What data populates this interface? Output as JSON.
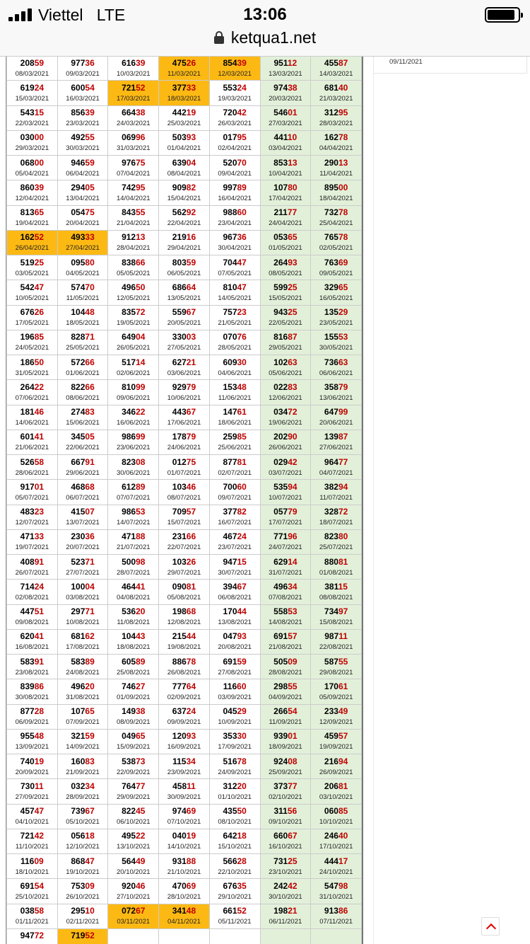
{
  "status_bar": {
    "carrier": "Viettel",
    "network": "LTE",
    "time": "13:06"
  },
  "url_bar": {
    "url": "ketqua1.net"
  },
  "sidebar": {
    "date": "09/11/2021"
  },
  "colors": {
    "weekend": "#e2f0d9",
    "highlight": "#fdb913",
    "tail": "#c00000"
  },
  "results": [
    [
      [
        "20859",
        "08/03/2021"
      ],
      [
        "97736",
        "09/03/2021"
      ],
      [
        "61639",
        "10/03/2021"
      ],
      [
        "47526",
        "11/03/2021",
        1
      ],
      [
        "85439",
        "12/03/2021",
        1
      ],
      [
        "95112",
        "13/03/2021"
      ],
      [
        "45587",
        "14/03/2021"
      ]
    ],
    [
      [
        "61924",
        "15/03/2021"
      ],
      [
        "60054",
        "16/03/2021"
      ],
      [
        "72152",
        "17/03/2021",
        1
      ],
      [
        "37733",
        "18/03/2021",
        1
      ],
      [
        "55324",
        "19/03/2021"
      ],
      [
        "97438",
        "20/03/2021"
      ],
      [
        "68140",
        "21/03/2021"
      ]
    ],
    [
      [
        "54315",
        "22/03/2021"
      ],
      [
        "85639",
        "23/03/2021"
      ],
      [
        "66438",
        "24/03/2021"
      ],
      [
        "44219",
        "25/03/2021"
      ],
      [
        "72042",
        "26/03/2021"
      ],
      [
        "54601",
        "27/03/2021"
      ],
      [
        "31295",
        "28/03/2021"
      ]
    ],
    [
      [
        "03000",
        "29/03/2021"
      ],
      [
        "49255",
        "30/03/2021"
      ],
      [
        "06996",
        "31/03/2021"
      ],
      [
        "50393",
        "01/04/2021"
      ],
      [
        "01795",
        "02/04/2021"
      ],
      [
        "44110",
        "03/04/2021"
      ],
      [
        "16278",
        "04/04/2021"
      ]
    ],
    [
      [
        "06800",
        "05/04/2021"
      ],
      [
        "94659",
        "06/04/2021"
      ],
      [
        "97675",
        "07/04/2021"
      ],
      [
        "63904",
        "08/04/2021"
      ],
      [
        "52070",
        "09/04/2021"
      ],
      [
        "85313",
        "10/04/2021"
      ],
      [
        "29013",
        "11/04/2021"
      ]
    ],
    [
      [
        "86039",
        "12/04/2021"
      ],
      [
        "29405",
        "13/04/2021"
      ],
      [
        "74295",
        "14/04/2021"
      ],
      [
        "90982",
        "15/04/2021"
      ],
      [
        "99789",
        "16/04/2021"
      ],
      [
        "10780",
        "17/04/2021"
      ],
      [
        "89500",
        "18/04/2021"
      ]
    ],
    [
      [
        "81365",
        "19/04/2021"
      ],
      [
        "05475",
        "20/04/2021"
      ],
      [
        "84355",
        "21/04/2021"
      ],
      [
        "56292",
        "22/04/2021"
      ],
      [
        "98860",
        "23/04/2021"
      ],
      [
        "21177",
        "24/04/2021"
      ],
      [
        "73278",
        "25/04/2021"
      ]
    ],
    [
      [
        "16252",
        "26/04/2021",
        1
      ],
      [
        "49333",
        "27/04/2021",
        1
      ],
      [
        "91213",
        "28/04/2021"
      ],
      [
        "21916",
        "29/04/2021"
      ],
      [
        "96736",
        "30/04/2021"
      ],
      [
        "05365",
        "01/05/2021"
      ],
      [
        "76578",
        "02/05/2021"
      ]
    ],
    [
      [
        "51925",
        "03/05/2021"
      ],
      [
        "09580",
        "04/05/2021"
      ],
      [
        "83866",
        "05/05/2021"
      ],
      [
        "80359",
        "06/05/2021"
      ],
      [
        "70447",
        "07/05/2021"
      ],
      [
        "26493",
        "08/05/2021"
      ],
      [
        "76369",
        "09/05/2021"
      ]
    ],
    [
      [
        "54247",
        "10/05/2021"
      ],
      [
        "57470",
        "11/05/2021"
      ],
      [
        "49650",
        "12/05/2021"
      ],
      [
        "68664",
        "13/05/2021"
      ],
      [
        "81047",
        "14/05/2021"
      ],
      [
        "59925",
        "15/05/2021"
      ],
      [
        "32965",
        "16/05/2021"
      ]
    ],
    [
      [
        "67626",
        "17/05/2021"
      ],
      [
        "10448",
        "18/05/2021"
      ],
      [
        "83572",
        "19/05/2021"
      ],
      [
        "55967",
        "20/05/2021"
      ],
      [
        "75723",
        "21/05/2021"
      ],
      [
        "94325",
        "22/05/2021"
      ],
      [
        "13529",
        "23/05/2021"
      ]
    ],
    [
      [
        "19685",
        "24/05/2021"
      ],
      [
        "82871",
        "25/05/2021"
      ],
      [
        "64904",
        "26/05/2021"
      ],
      [
        "33003",
        "27/05/2021"
      ],
      [
        "07076",
        "28/05/2021"
      ],
      [
        "81687",
        "29/05/2021"
      ],
      [
        "15553",
        "30/05/2021"
      ]
    ],
    [
      [
        "18650",
        "31/05/2021"
      ],
      [
        "57266",
        "01/06/2021"
      ],
      [
        "51714",
        "02/06/2021"
      ],
      [
        "62721",
        "03/06/2021"
      ],
      [
        "60930",
        "04/06/2021"
      ],
      [
        "10263",
        "05/06/2021"
      ],
      [
        "73663",
        "06/06/2021"
      ]
    ],
    [
      [
        "26422",
        "07/06/2021"
      ],
      [
        "82266",
        "08/06/2021"
      ],
      [
        "81099",
        "09/06/2021"
      ],
      [
        "92979",
        "10/06/2021"
      ],
      [
        "15348",
        "11/06/2021"
      ],
      [
        "02283",
        "12/06/2021"
      ],
      [
        "35879",
        "13/06/2021"
      ]
    ],
    [
      [
        "18146",
        "14/06/2021"
      ],
      [
        "27483",
        "15/06/2021"
      ],
      [
        "34622",
        "16/06/2021"
      ],
      [
        "44367",
        "17/06/2021"
      ],
      [
        "14761",
        "18/06/2021"
      ],
      [
        "03472",
        "19/06/2021"
      ],
      [
        "64799",
        "20/06/2021"
      ]
    ],
    [
      [
        "60141",
        "21/06/2021"
      ],
      [
        "34505",
        "22/06/2021"
      ],
      [
        "98699",
        "23/06/2021"
      ],
      [
        "17879",
        "24/06/2021"
      ],
      [
        "25985",
        "25/06/2021"
      ],
      [
        "20290",
        "26/06/2021"
      ],
      [
        "13987",
        "27/06/2021"
      ]
    ],
    [
      [
        "52658",
        "28/06/2021"
      ],
      [
        "66791",
        "29/06/2021"
      ],
      [
        "82308",
        "30/06/2021"
      ],
      [
        "01275",
        "01/07/2021"
      ],
      [
        "87781",
        "02/07/2021"
      ],
      [
        "02942",
        "03/07/2021"
      ],
      [
        "96477",
        "04/07/2021"
      ]
    ],
    [
      [
        "91701",
        "05/07/2021"
      ],
      [
        "46868",
        "06/07/2021"
      ],
      [
        "61289",
        "07/07/2021"
      ],
      [
        "10346",
        "08/07/2021"
      ],
      [
        "70060",
        "09/07/2021"
      ],
      [
        "53594",
        "10/07/2021"
      ],
      [
        "38294",
        "11/07/2021"
      ]
    ],
    [
      [
        "48323",
        "12/07/2021"
      ],
      [
        "41507",
        "13/07/2021"
      ],
      [
        "98653",
        "14/07/2021"
      ],
      [
        "70957",
        "15/07/2021"
      ],
      [
        "37782",
        "16/07/2021"
      ],
      [
        "05779",
        "17/07/2021"
      ],
      [
        "32872",
        "18/07/2021"
      ]
    ],
    [
      [
        "47133",
        "19/07/2021"
      ],
      [
        "23036",
        "20/07/2021"
      ],
      [
        "47188",
        "21/07/2021"
      ],
      [
        "23166",
        "22/07/2021"
      ],
      [
        "46724",
        "23/07/2021"
      ],
      [
        "77196",
        "24/07/2021"
      ],
      [
        "82380",
        "25/07/2021"
      ]
    ],
    [
      [
        "40891",
        "26/07/2021"
      ],
      [
        "52371",
        "27/07/2021"
      ],
      [
        "50098",
        "28/07/2021"
      ],
      [
        "10326",
        "29/07/2021"
      ],
      [
        "94715",
        "30/07/2021"
      ],
      [
        "62914",
        "31/07/2021"
      ],
      [
        "88081",
        "01/08/2021"
      ]
    ],
    [
      [
        "71424",
        "02/08/2021"
      ],
      [
        "10004",
        "03/08/2021"
      ],
      [
        "46441",
        "04/08/2021"
      ],
      [
        "09081",
        "05/08/2021"
      ],
      [
        "39467",
        "06/08/2021"
      ],
      [
        "49634",
        "07/08/2021"
      ],
      [
        "38115",
        "08/08/2021"
      ]
    ],
    [
      [
        "44751",
        "09/08/2021"
      ],
      [
        "29771",
        "10/08/2021"
      ],
      [
        "53620",
        "11/08/2021"
      ],
      [
        "19868",
        "12/08/2021"
      ],
      [
        "17044",
        "13/08/2021"
      ],
      [
        "55853",
        "14/08/2021"
      ],
      [
        "73497",
        "15/08/2021"
      ]
    ],
    [
      [
        "62041",
        "16/08/2021"
      ],
      [
        "68162",
        "17/08/2021"
      ],
      [
        "10443",
        "18/08/2021"
      ],
      [
        "21544",
        "19/08/2021"
      ],
      [
        "04793",
        "20/08/2021"
      ],
      [
        "69157",
        "21/08/2021"
      ],
      [
        "98711",
        "22/08/2021"
      ]
    ],
    [
      [
        "58391",
        "23/08/2021"
      ],
      [
        "58389",
        "24/08/2021"
      ],
      [
        "60589",
        "25/08/2021"
      ],
      [
        "88678",
        "26/08/2021"
      ],
      [
        "69159",
        "27/08/2021"
      ],
      [
        "50509",
        "28/08/2021"
      ],
      [
        "58755",
        "29/08/2021"
      ]
    ],
    [
      [
        "83986",
        "30/08/2021"
      ],
      [
        "49620",
        "31/08/2021"
      ],
      [
        "74627",
        "01/09/2021"
      ],
      [
        "77764",
        "02/09/2021"
      ],
      [
        "11660",
        "03/09/2021"
      ],
      [
        "29855",
        "04/09/2021"
      ],
      [
        "17061",
        "05/09/2021"
      ]
    ],
    [
      [
        "87728",
        "06/09/2021"
      ],
      [
        "10765",
        "07/09/2021"
      ],
      [
        "14938",
        "08/09/2021"
      ],
      [
        "63724",
        "09/09/2021"
      ],
      [
        "04529",
        "10/09/2021"
      ],
      [
        "26654",
        "11/09/2021"
      ],
      [
        "23349",
        "12/09/2021"
      ]
    ],
    [
      [
        "95548",
        "13/09/2021"
      ],
      [
        "32159",
        "14/09/2021"
      ],
      [
        "04965",
        "15/09/2021"
      ],
      [
        "12093",
        "16/09/2021"
      ],
      [
        "35330",
        "17/09/2021"
      ],
      [
        "93901",
        "18/09/2021"
      ],
      [
        "45957",
        "19/09/2021"
      ]
    ],
    [
      [
        "74019",
        "20/09/2021"
      ],
      [
        "16083",
        "21/09/2021"
      ],
      [
        "53873",
        "22/09/2021"
      ],
      [
        "11534",
        "23/09/2021"
      ],
      [
        "51678",
        "24/09/2021"
      ],
      [
        "92408",
        "25/09/2021"
      ],
      [
        "21694",
        "26/09/2021"
      ]
    ],
    [
      [
        "73011",
        "27/09/2021"
      ],
      [
        "03234",
        "28/09/2021"
      ],
      [
        "76477",
        "29/09/2021"
      ],
      [
        "45811",
        "30/09/2021"
      ],
      [
        "31220",
        "01/10/2021"
      ],
      [
        "37377",
        "02/10/2021"
      ],
      [
        "20681",
        "03/10/2021"
      ]
    ],
    [
      [
        "45747",
        "04/10/2021"
      ],
      [
        "73967",
        "05/10/2021"
      ],
      [
        "82245",
        "06/10/2021"
      ],
      [
        "97469",
        "07/10/2021"
      ],
      [
        "43550",
        "08/10/2021"
      ],
      [
        "31156",
        "09/10/2021"
      ],
      [
        "06085",
        "10/10/2021"
      ]
    ],
    [
      [
        "72142",
        "11/10/2021"
      ],
      [
        "05618",
        "12/10/2021"
      ],
      [
        "49522",
        "13/10/2021"
      ],
      [
        "04019",
        "14/10/2021"
      ],
      [
        "64218",
        "15/10/2021"
      ],
      [
        "66067",
        "16/10/2021"
      ],
      [
        "24640",
        "17/10/2021"
      ]
    ],
    [
      [
        "11609",
        "18/10/2021"
      ],
      [
        "86847",
        "19/10/2021"
      ],
      [
        "56449",
        "20/10/2021"
      ],
      [
        "93188",
        "21/10/2021"
      ],
      [
        "56628",
        "22/10/2021"
      ],
      [
        "73125",
        "23/10/2021"
      ],
      [
        "44417",
        "24/10/2021"
      ]
    ],
    [
      [
        "69154",
        "25/10/2021"
      ],
      [
        "75309",
        "26/10/2021"
      ],
      [
        "92046",
        "27/10/2021"
      ],
      [
        "47069",
        "28/10/2021"
      ],
      [
        "67635",
        "29/10/2021"
      ],
      [
        "24242",
        "30/10/2021"
      ],
      [
        "54798",
        "31/10/2021"
      ]
    ],
    [
      [
        "03858",
        "01/11/2021"
      ],
      [
        "29510",
        "02/11/2021"
      ],
      [
        "07267",
        "03/11/2021",
        1
      ],
      [
        "34148",
        "04/11/2021",
        1
      ],
      [
        "66152",
        "05/11/2021"
      ],
      [
        "19821",
        "06/11/2021"
      ],
      [
        "91386",
        "07/11/2021"
      ]
    ],
    [
      [
        "94772",
        ""
      ],
      [
        "71952",
        "",
        1
      ],
      [
        "",
        ""
      ],
      [
        "",
        ""
      ],
      [
        "",
        ""
      ],
      [
        "",
        ""
      ],
      [
        "",
        ""
      ]
    ]
  ]
}
